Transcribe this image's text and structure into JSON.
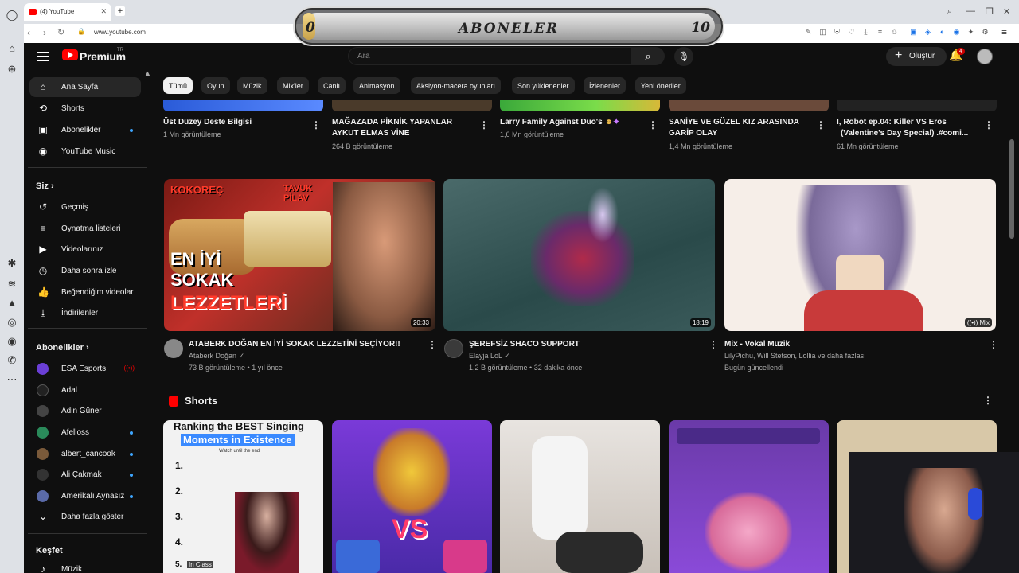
{
  "browser": {
    "tab_title": "(4) YouTube",
    "url": "www.youtube.com"
  },
  "overlay": {
    "title": "ABONELER",
    "min": "0",
    "max": "10",
    "progress_fraction": 0.03
  },
  "header": {
    "logo_text": "Premium",
    "logo_tr": "TR",
    "search_placeholder": "Ara",
    "create_label": "Oluştur",
    "notification_count": "4"
  },
  "sidebar": {
    "main": [
      {
        "label": "Ana Sayfa",
        "icon": "home-icon",
        "active": true
      },
      {
        "label": "Shorts",
        "icon": "shorts-icon"
      },
      {
        "label": "Abonelikler",
        "icon": "subscriptions-icon"
      },
      {
        "label": "YouTube Music",
        "icon": "music-icon"
      }
    ],
    "you_heading": "Siz",
    "you_items": [
      {
        "label": "Geçmiş",
        "icon": "history-icon"
      },
      {
        "label": "Oynatma listeleri",
        "icon": "playlists-icon"
      },
      {
        "label": "Videolarınız",
        "icon": "your-videos-icon"
      },
      {
        "label": "Daha sonra izle",
        "icon": "watch-later-icon"
      },
      {
        "label": "Beğendiğim videolar",
        "icon": "liked-icon"
      },
      {
        "label": "İndirilenler",
        "icon": "downloads-icon"
      }
    ],
    "subs_heading": "Abonelikler",
    "subs": [
      {
        "label": "ESA Esports",
        "color": "#6b3fd6"
      },
      {
        "label": "Adal",
        "color": "#222222"
      },
      {
        "label": "Adin Güner",
        "color": "#444444"
      },
      {
        "label": "Afelloss",
        "color": "#2a8a5a"
      },
      {
        "label": "albert_cancook",
        "color": "#7a5a3a"
      },
      {
        "label": "Ali Çakmak",
        "color": "#333333"
      },
      {
        "label": "Amerikalı Aynasız",
        "color": "#5a6aa8"
      }
    ],
    "show_more": "Daha fazla göster",
    "explore_heading": "Keşfet",
    "explore_first": "Müzik"
  },
  "chips": [
    "Tümü",
    "Oyun",
    "Müzik",
    "Mix'ler",
    "Canlı",
    "Animasyon",
    "Aksiyon-macera oyunları",
    "Son yüklenenler",
    "İzlenenler",
    "Yeni öneriler"
  ],
  "top_row": [
    {
      "title1": "Üst Düzey Deste Bilgisi",
      "title2": "",
      "meta": "1 Mn görüntüleme"
    },
    {
      "title1": "MAĞAZADA PİKNİK YAPANLAR",
      "title2": "AYKUT ELMAS VİNE",
      "meta": "264 B görüntüleme"
    },
    {
      "title1": "Larry Family Against Duo's",
      "title2": "",
      "meta": "1,6 Mn görüntüleme"
    },
    {
      "title1": "SANİYE VE GÜZEL KIZ ARASINDA",
      "title2": "GARİP OLAY",
      "meta": "1,4 Mn görüntüleme"
    },
    {
      "title1": "I,  Robot ep.04: Killer VS Eros",
      "title2": "(Valentine's Day Special)  .#comi...",
      "meta": "61 Mn görüntüleme"
    }
  ],
  "videos": [
    {
      "title": "ATABERK DOĞAN EN İYİ SOKAK LEZZETİNİ SEÇİYOR!!",
      "channel": "Ataberk Doğan",
      "meta": "73 B görüntüleme • 1 yıl önce",
      "duration": "20:33",
      "thumb_text1": "EN İYİ",
      "thumb_text2": "SOKAK",
      "thumb_text3": "LEZZETLERİ",
      "thumb_tag1": "KOKOREÇ",
      "thumb_tag2": "TAVUK PİLAV"
    },
    {
      "title": "ŞEREFSİZ SHACO SUPPORT",
      "channel": "Elayja LoL",
      "meta": "1,2 B görüntüleme • 32 dakika önce",
      "duration": "18:19"
    },
    {
      "title": "Mix - Vokal Müzik",
      "channel": "LilyPichu, Will Stetson, Lollia ve daha fazlası",
      "meta": "Bugün güncellendi",
      "duration": "Mix"
    }
  ],
  "shorts": {
    "heading": "Shorts",
    "s1_text1": "Ranking the BEST Singing",
    "s1_text2": "Moments in Existence",
    "s1_sub": "Watch until the end",
    "s1_nums": [
      "1.",
      "2.",
      "3.",
      "4.",
      "5."
    ],
    "s1_last": "In Class",
    "s2_vs": "VS"
  }
}
